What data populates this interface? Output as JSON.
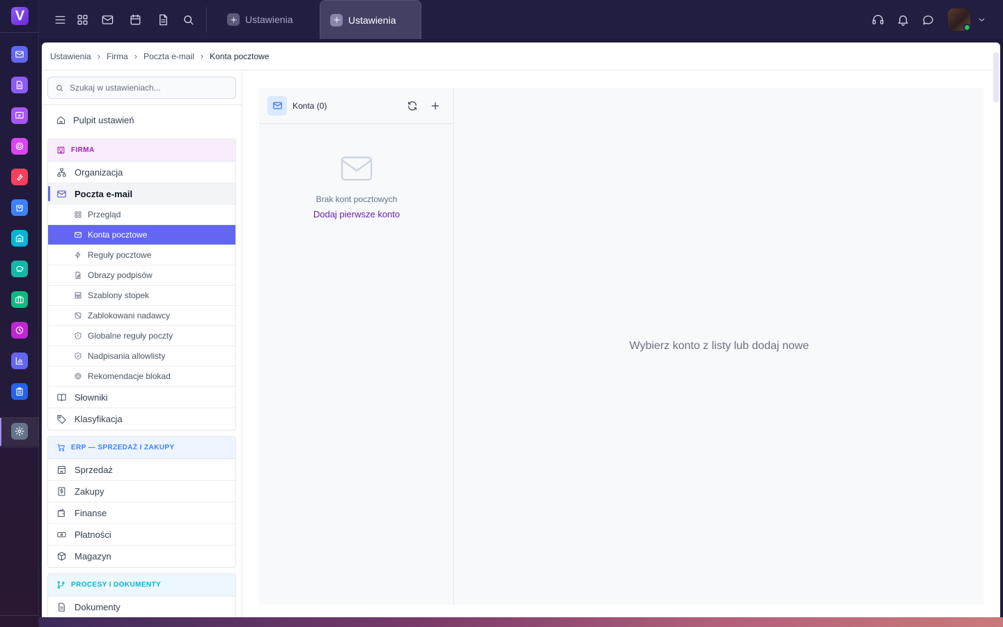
{
  "app": {
    "logo_letter": "V"
  },
  "rail": {
    "items": [
      {
        "name": "mail",
        "color": "#6366f1"
      },
      {
        "name": "documents",
        "color": "#8b5cf6"
      },
      {
        "name": "tasks",
        "color": "#a855f7"
      },
      {
        "name": "target",
        "color": "#d946ef"
      },
      {
        "name": "tools",
        "color": "#f43f5e"
      },
      {
        "name": "shop",
        "color": "#3b82f6"
      },
      {
        "name": "warehouse",
        "color": "#06b6d4"
      },
      {
        "name": "finance",
        "color": "#14b8a6"
      },
      {
        "name": "cases",
        "color": "#10b981"
      },
      {
        "name": "time",
        "color": "#c026d3"
      },
      {
        "name": "reports",
        "color": "#6366f1"
      },
      {
        "name": "clipboard",
        "color": "#2563eb"
      },
      {
        "name": "settings",
        "color": "#64748b"
      }
    ]
  },
  "tabs": [
    {
      "label": "Ustawienia",
      "active": false
    },
    {
      "label": "Ustawienia",
      "active": true
    }
  ],
  "breadcrumb": [
    "Ustawienia",
    "Firma",
    "Poczta e-mail",
    "Konta pocztowe"
  ],
  "sidebar": {
    "search_placeholder": "Szukaj w ustawieniach...",
    "dashboard": "Pulpit ustawień",
    "groups": [
      {
        "title": "FIRMA",
        "color": "#a21caf",
        "bg": "#f8eefb",
        "rows": [
          {
            "label": "Organizacja"
          },
          {
            "label": "Poczta e-mail",
            "open": true,
            "children": [
              "Przegląd",
              "Konta pocztowe",
              "Reguły pocztowe",
              "Obrazy podpisów",
              "Szablony stopek",
              "Zablokowani nadawcy",
              "Globalne reguły poczty",
              "Nadpisania allowlisty",
              "Rekomendacje blokad"
            ],
            "active_child": "Konta pocztowe"
          },
          {
            "label": "Słowniki"
          },
          {
            "label": "Klasyfikacja"
          }
        ]
      },
      {
        "title": "ERP — SPRZEDAŻ I ZAKUPY",
        "color": "#3b82f6",
        "bg": "#eef4fd",
        "rows": [
          {
            "label": "Sprzedaż"
          },
          {
            "label": "Zakupy"
          },
          {
            "label": "Finanse"
          },
          {
            "label": "Płatności"
          },
          {
            "label": "Magazyn"
          }
        ]
      },
      {
        "title": "PROCESY I DOKUMENTY",
        "color": "#06b6d4",
        "bg": "#ecf8fb",
        "rows": [
          {
            "label": "Dokumenty"
          }
        ]
      }
    ]
  },
  "accounts": {
    "header": "Konta (0)",
    "empty_text": "Brak kont pocztowych",
    "empty_link": "Dodaj pierwsze konto"
  },
  "detail": {
    "placeholder": "Wybierz konto z listy lub dodaj nowe"
  }
}
